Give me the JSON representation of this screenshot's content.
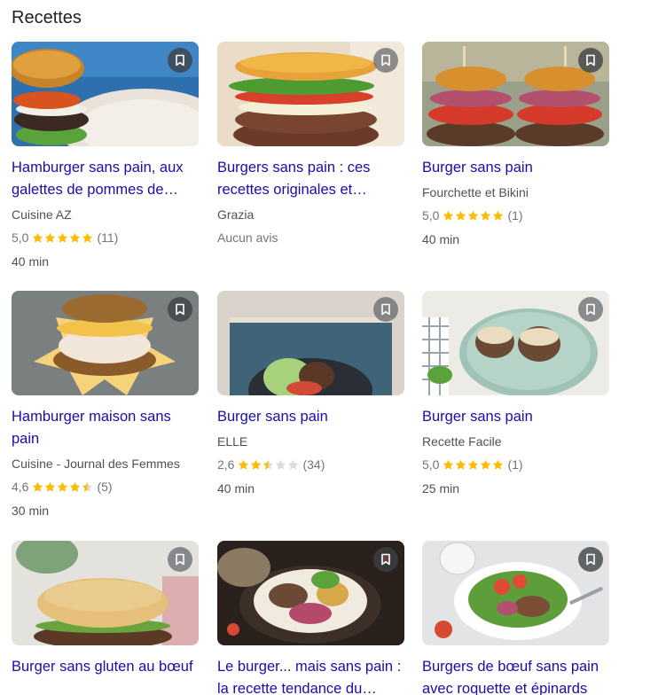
{
  "section": {
    "title": "Recettes"
  },
  "colors": {
    "link": "#1a0dab",
    "star": "#fbbc04",
    "star_empty": "#dadce0",
    "meta": "#70757a"
  },
  "cards": [
    {
      "title": "Hamburger sans pain, aux galettes de pommes de terre",
      "display_title": "Hamburger sans pain, aux galettes de pommes de…",
      "source": "Cuisine AZ",
      "rating": "5,0",
      "stars": 5,
      "reviews": "(11)",
      "time": "40 min",
      "save_icon": "bookmark-icon"
    },
    {
      "title": "Burgers sans pain : ces recettes originales et…",
      "display_title": "Burgers sans pain : ces recettes originales et…",
      "source": "Grazia",
      "no_rating_text": "Aucun avis",
      "save_icon": "bookmark-icon"
    },
    {
      "title": "Burger sans pain",
      "display_title": "Burger sans pain",
      "source": "Fourchette et Bikini",
      "rating": "5,0",
      "stars": 5,
      "reviews": "(1)",
      "time": "40 min",
      "save_icon": "bookmark-icon"
    },
    {
      "title": "Hamburger maison sans pain",
      "display_title": "Hamburger maison sans pain",
      "source": "Cuisine - Journal des Femmes",
      "rating": "4,6",
      "stars": 4.5,
      "reviews": "(5)",
      "time": "30 min",
      "save_icon": "bookmark-icon"
    },
    {
      "title": "Burger sans pain",
      "display_title": "Burger sans pain",
      "source": "ELLE",
      "rating": "2,6",
      "stars": 2.5,
      "reviews": "(34)",
      "time": "40 min",
      "save_icon": "bookmark-icon"
    },
    {
      "title": "Burger sans pain",
      "display_title": "Burger sans pain",
      "source": "Recette Facile",
      "rating": "5,0",
      "stars": 5,
      "reviews": "(1)",
      "time": "25 min",
      "save_icon": "bookmark-icon"
    },
    {
      "title": "Burger sans gluten au bœuf",
      "display_title": "Burger sans gluten au bœuf",
      "save_icon": "bookmark-icon"
    },
    {
      "title": "Le burger... mais sans pain : la recette tendance du…",
      "display_title": "Le burger... mais sans pain : la recette tendance du…",
      "save_icon": "bookmark-icon"
    },
    {
      "title": "Burgers de bœuf sans pain avec roquette et épinards",
      "display_title": "Burgers de bœuf sans pain avec roquette et épinards",
      "save_icon": "bookmark-icon"
    }
  ]
}
